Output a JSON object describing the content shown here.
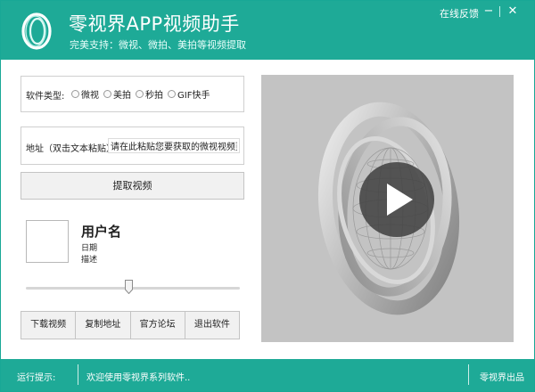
{
  "window": {
    "title": "零视界APP视频助手",
    "subtitle": "完美支持：微视、微拍、美拍等视频提取",
    "feedback": "在线反馈",
    "minimize_glyph": "−",
    "close_glyph": "✕",
    "accent_color": "#1eaa97"
  },
  "software_type": {
    "label": "软件类型:",
    "options": [
      "微视",
      "美拍",
      "秒拍",
      "GIF快手"
    ]
  },
  "address": {
    "label": "地址（双击文本粘贴）",
    "value": "请在此粘贴您要获取的微视视频页"
  },
  "extract_button": "提取视频",
  "user": {
    "name": "用户名",
    "date": "日期",
    "description": "描述"
  },
  "slider": {
    "value_fraction": 0.48
  },
  "actions": [
    "下载视频",
    "复制地址",
    "官方论坛",
    "退出软件"
  ],
  "video": {
    "play_icon": "play-icon",
    "background": "#c3c3c3"
  },
  "status": {
    "label": "运行提示:",
    "message": "欢迎使用零视界系列软件..",
    "brand": "零视界出品"
  }
}
